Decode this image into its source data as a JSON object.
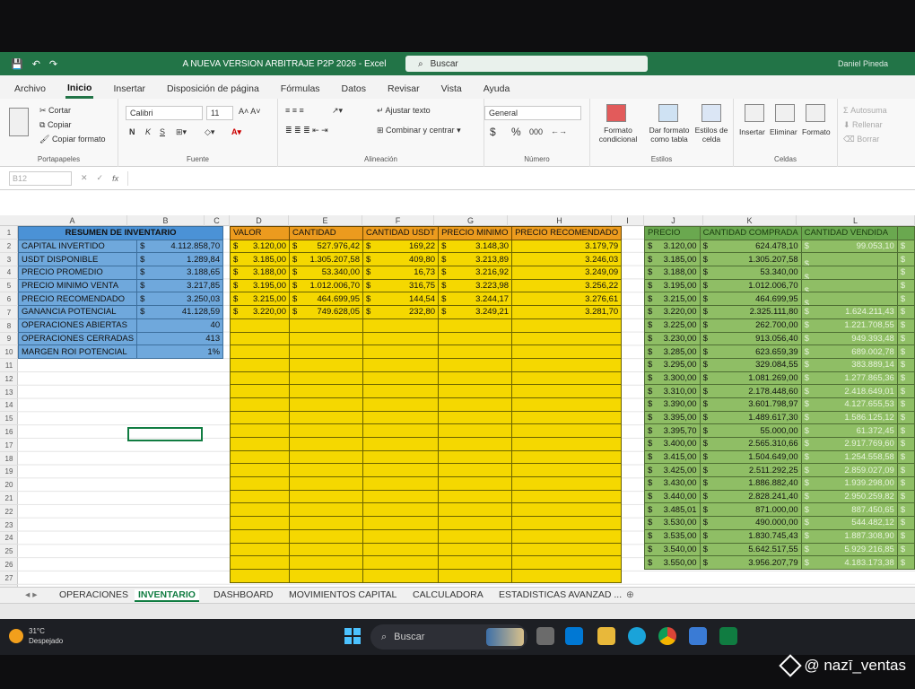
{
  "window": {
    "title": "A NUEVA VERSION ARBITRAJE P2P 2026 - Excel",
    "search_placeholder": "Buscar",
    "user": "Daniel Pineda"
  },
  "menu": [
    "Archivo",
    "Inicio",
    "Insertar",
    "Disposición de página",
    "Fórmulas",
    "Datos",
    "Revisar",
    "Vista",
    "Ayuda"
  ],
  "ribbon": {
    "clipboard": {
      "cut": "Cortar",
      "copy": "Copiar",
      "format_painter": "Copiar formato",
      "label": "Portapapeles"
    },
    "font": {
      "name": "Calibri",
      "size": "11",
      "bold": "N",
      "italic": "K",
      "underline": "S",
      "label": "Fuente"
    },
    "alignment": {
      "wrap": "Ajustar texto",
      "merge": "Combinar y centrar",
      "label": "Alineación"
    },
    "number": {
      "format": "General",
      "currency": "$",
      "percent": "%",
      "thousands": "000",
      "label": "Número"
    },
    "styles": {
      "conditional": "Formato condicional",
      "table": "Dar formato como tabla",
      "cell": "Estilos de celda",
      "label": "Estilos"
    },
    "cells": {
      "insert": "Insertar",
      "delete": "Eliminar",
      "format": "Formato",
      "label": "Celdas"
    },
    "editing": {
      "autosum": "Autosuma",
      "fill": "Rellenar",
      "clear": "Borrar"
    }
  },
  "formula_bar": {
    "name_box": "B12",
    "fx": "fx"
  },
  "columns": [
    "A",
    "B",
    "C",
    "D",
    "E",
    "F",
    "G",
    "H",
    "I",
    "J",
    "K",
    "L"
  ],
  "summary": {
    "title": "RESUMEN DE INVENTARIO",
    "rows": [
      {
        "label": "CAPITAL INVERTIDO",
        "cur": "$",
        "value": "4.112.858,70"
      },
      {
        "label": "USDT DISPONIBLE",
        "cur": "$",
        "value": "1.289,84"
      },
      {
        "label": "PRECIO PROMEDIO",
        "cur": "$",
        "value": "3.188,65"
      },
      {
        "label": "PRECIO MINIMO VENTA",
        "cur": "$",
        "value": "3.217,85"
      },
      {
        "label": "PRECIO RECOMENDADO",
        "cur": "$",
        "value": "3.250,03"
      },
      {
        "label": "GANANCIA POTENCIAL",
        "cur": "$",
        "value": "41.128,59"
      },
      {
        "label": "OPERACIONES ABIERTAS",
        "cur": "",
        "value": "40"
      },
      {
        "label": "OPERACIONES CERRADAS",
        "cur": "",
        "value": "413"
      },
      {
        "label": "MARGEN ROI POTENCIAL",
        "cur": "",
        "value": "1%"
      }
    ]
  },
  "inventory": {
    "headers": [
      "VALOR",
      "CANTIDAD",
      "CANTIDAD USDT",
      "PRECIO MINIMO",
      "PRECIO RECOMENDADO"
    ],
    "rows": [
      [
        "3.120,00",
        "527.976,42",
        "169,22",
        "3.148,30",
        "3.179,79"
      ],
      [
        "3.185,00",
        "1.305.207,58",
        "409,80",
        "3.213,89",
        "3.246,03"
      ],
      [
        "3.188,00",
        "53.340,00",
        "16,73",
        "3.216,92",
        "3.249,09"
      ],
      [
        "3.195,00",
        "1.012.006,70",
        "316,75",
        "3.223,98",
        "3.256,22"
      ],
      [
        "3.215,00",
        "464.699,95",
        "144,54",
        "3.244,17",
        "3.276,61"
      ],
      [
        "3.220,00",
        "749.628,05",
        "232,80",
        "3.249,21",
        "3.281,70"
      ]
    ]
  },
  "history": {
    "headers": [
      "PRECIO",
      "CANTIDAD COMPRADA",
      "CANTIDAD VENDIDA"
    ],
    "rows": [
      [
        "3.120,00",
        "624.478,10",
        "99.053,10"
      ],
      [
        "3.185,00",
        "1.305.207,58",
        ""
      ],
      [
        "3.188,00",
        "53.340,00",
        ""
      ],
      [
        "3.195,00",
        "1.012.006,70",
        ""
      ],
      [
        "3.215,00",
        "464.699,95",
        ""
      ],
      [
        "3.220,00",
        "2.325.111,80",
        "1.624.211,43"
      ],
      [
        "3.225,00",
        "262.700,00",
        "1.221.708,55"
      ],
      [
        "3.230,00",
        "913.056,40",
        "949.393,48"
      ],
      [
        "3.285,00",
        "623.659,39",
        "689.002,78"
      ],
      [
        "3.295,00",
        "329.084,55",
        "383.889,14"
      ],
      [
        "3.300,00",
        "1.081.269,00",
        "1.277.865,36"
      ],
      [
        "3.310,00",
        "2.178.448,60",
        "2.418.649,01"
      ],
      [
        "3.390,00",
        "3.601.798,97",
        "4.127.655,53"
      ],
      [
        "3.395,00",
        "1.489.617,30",
        "1.586.125,12"
      ],
      [
        "3.395,70",
        "55.000,00",
        "61.372,45"
      ],
      [
        "3.400,00",
        "2.565.310,66",
        "2.917.769,60"
      ],
      [
        "3.415,00",
        "1.504.649,00",
        "1.254.558,58"
      ],
      [
        "3.425,00",
        "2.511.292,25",
        "2.859.027,09"
      ],
      [
        "3.430,00",
        "1.886.882,40",
        "1.939.298,00"
      ],
      [
        "3.440,00",
        "2.828.241,40",
        "2.950.259,82"
      ],
      [
        "3.485,01",
        "871.000,00",
        "887.450,65"
      ],
      [
        "3.530,00",
        "490.000,00",
        "544.482,12"
      ],
      [
        "3.535,00",
        "1.830.745,43",
        "1.887.308,90"
      ],
      [
        "3.540,00",
        "5.642.517,55",
        "5.929.216,85"
      ],
      [
        "3.550,00",
        "3.956.207,79",
        "4.183.173,38"
      ]
    ]
  },
  "sheet_tabs": [
    "OPERACIONES",
    "INVENTARIO",
    "DASHBOARD",
    "MOVIMIENTOS CAPITAL",
    "CALCULADORA",
    "ESTADISTICAS AVANZAD ..."
  ],
  "taskbar": {
    "weather_temp": "31°C",
    "weather_desc": "Despejado",
    "search": "Buscar"
  },
  "watermark": "@ nazī_ventas",
  "colors": {
    "excel_green": "#227447",
    "summary_blue": "#6fa8dc",
    "inventory_yellow": "#f5d800",
    "header_orange": "#ec9b1e",
    "history_green": "#8fbe65"
  }
}
